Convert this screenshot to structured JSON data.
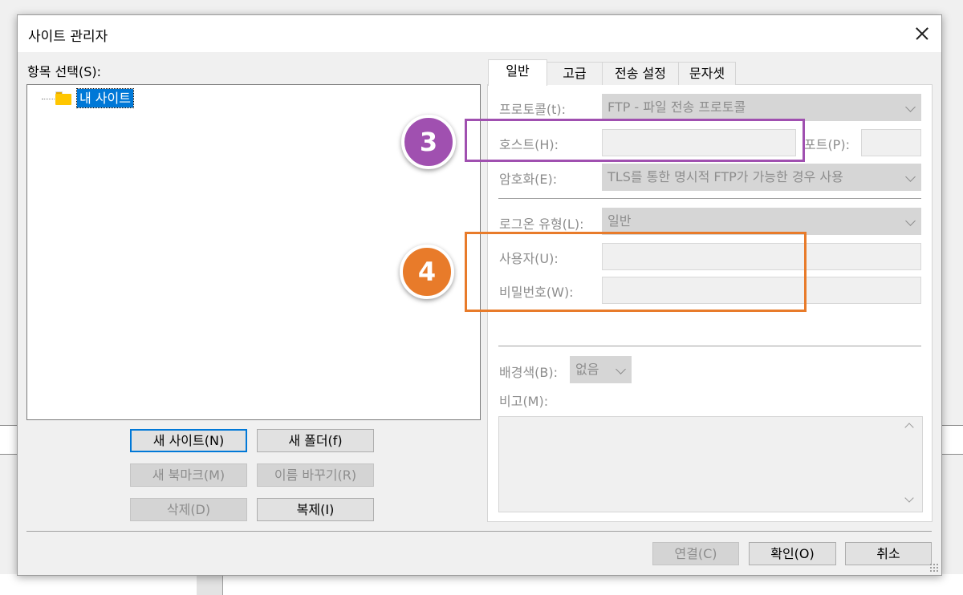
{
  "window": {
    "title": "사이트 관리자"
  },
  "left_panel": {
    "label": "항목 선택(S):",
    "tree_items": [
      {
        "label": "내 사이트"
      }
    ],
    "buttons": {
      "new_site": "새 사이트(N)",
      "new_folder": "새 폴더(f)",
      "new_bookmark": "새 북마크(M)",
      "rename": "이름 바꾸기(R)",
      "delete": "삭제(D)",
      "duplicate": "복제(I)"
    }
  },
  "tabs": [
    {
      "label": "일반",
      "active": true
    },
    {
      "label": "고급",
      "active": false
    },
    {
      "label": "전송 설정",
      "active": false
    },
    {
      "label": "문자셋",
      "active": false
    }
  ],
  "general": {
    "protocol_label": "프로토콜(t):",
    "protocol_value": "FTP - 파일 전송 프로토콜",
    "host_label": "호스트(H):",
    "host_value": "",
    "port_label": "포트(P):",
    "port_value": "",
    "encryption_label": "암호화(E):",
    "encryption_value": "TLS를 통한 명시적 FTP가 가능한 경우 사용",
    "logon_label": "로그온 유형(L):",
    "logon_value": "일반",
    "user_label": "사용자(U):",
    "user_value": "",
    "password_label": "비밀번호(W):",
    "password_value": "",
    "bgcolor_label": "배경색(B):",
    "bgcolor_value": "없음",
    "comment_label": "비고(M):",
    "comment_value": ""
  },
  "footer": {
    "connect": "연결(C)",
    "ok": "확인(O)",
    "cancel": "취소"
  },
  "annotations": [
    {
      "number": "3",
      "color": "#a050b0"
    },
    {
      "number": "4",
      "color": "#e87b2a"
    }
  ]
}
